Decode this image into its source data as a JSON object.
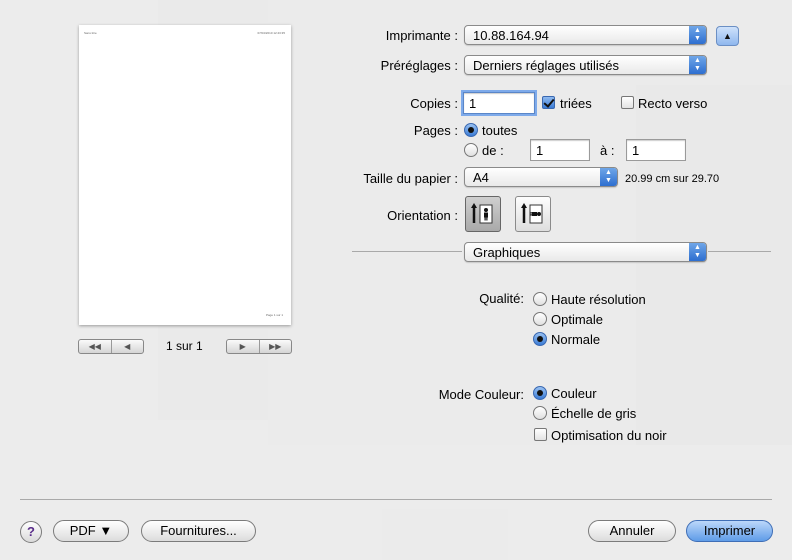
{
  "preview": {
    "header_left": "Sans titre",
    "header_right": "07/04/2010 12:43:35",
    "footer": "Page 1 sur 1",
    "page_indicator": "1 sur 1",
    "nav_first": "◀◀",
    "nav_prev": "◀",
    "nav_next": "▶",
    "nav_last": "▶▶"
  },
  "printer": {
    "label": "Imprimante :",
    "value": "10.88.164.94"
  },
  "presets": {
    "label": "Préréglages :",
    "value": "Derniers réglages utilisés"
  },
  "copies": {
    "label": "Copies :",
    "value": "1",
    "collated_label": "triées",
    "collated": true,
    "duplex_label": "Recto verso",
    "duplex": false
  },
  "pages": {
    "label": "Pages :",
    "all_label": "toutes",
    "from_label": "de :",
    "from_value": "1",
    "to_label": "à :",
    "to_value": "1",
    "selected": "all"
  },
  "paper_size": {
    "label": "Taille du papier :",
    "value": "A4",
    "dimensions": "20.99 cm sur 29.70"
  },
  "orientation": {
    "label": "Orientation :",
    "selected": "portrait"
  },
  "panel": {
    "value": "Graphiques"
  },
  "quality": {
    "label": "Qualité:",
    "options": [
      "Haute résolution",
      "Optimale",
      "Normale"
    ],
    "selected": "Normale"
  },
  "color_mode": {
    "label": "Mode Couleur:",
    "options": [
      "Couleur",
      "Échelle de gris"
    ],
    "selected": "Couleur",
    "black_optimization_label": "Optimisation du noir",
    "black_optimization": false
  },
  "buttons": {
    "help": "?",
    "pdf": "PDF ▼",
    "supplies": "Fournitures...",
    "cancel": "Annuler",
    "print": "Imprimer"
  },
  "icons": {
    "arrows": "up-down-arrows-icon",
    "disclosure": "disclosure-up-icon",
    "portrait": "portrait-orientation-icon",
    "landscape": "landscape-orientation-icon"
  },
  "colors": {
    "accent": "#3a7bd5",
    "default_button": "#5f9ce8"
  }
}
